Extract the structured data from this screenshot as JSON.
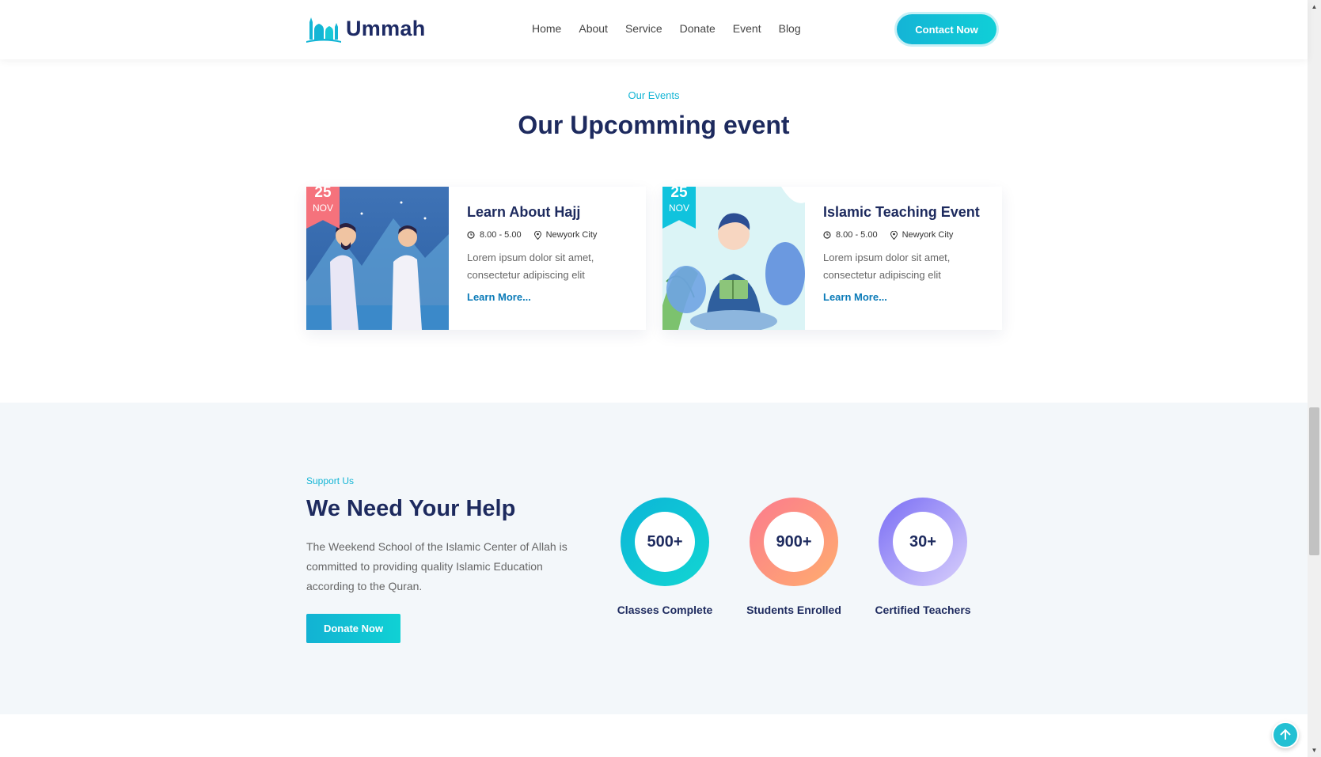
{
  "header": {
    "logo_text": "Ummah",
    "nav": [
      "Home",
      "About",
      "Service",
      "Donate",
      "Event",
      "Blog"
    ],
    "contact_label": "Contact Now"
  },
  "events_section": {
    "subtitle": "Our Events",
    "title": "Our Upcomming event",
    "events": [
      {
        "day": "25",
        "month": "NOV",
        "title": "Learn About Hajj",
        "time": "8.00 - 5.00",
        "location": "Newyork City",
        "description": "Lorem ipsum dolor sit amet, consectetur adipiscing elit",
        "link": "Learn More...",
        "tag_color": "#f5727c"
      },
      {
        "day": "25",
        "month": "NOV",
        "title": "Islamic Teaching Event",
        "time": "8.00 - 5.00",
        "location": "Newyork City",
        "description": "Lorem ipsum dolor sit amet, consectetur adipiscing elit",
        "link": "Learn More...",
        "tag_color": "#10c3dd"
      }
    ]
  },
  "help_section": {
    "subtitle": "Support Us",
    "title": "We Need Your Help",
    "description": "The Weekend School of the Islamic Center of Allah is committed to providing quality Islamic Education according to the Quran.",
    "donate_label": "Donate Now",
    "stats": [
      {
        "value": "500+",
        "label": "Classes Complete",
        "color_from": "#0cb5d8",
        "color_to": "#12d6d2"
      },
      {
        "value": "900+",
        "label": "Students Enrolled",
        "color_from": "#fb7b8e",
        "color_to": "#ffad6e"
      },
      {
        "value": "30+",
        "label": "Certified Teachers",
        "color_from": "#7a6ef5",
        "color_to": "#d9d0fb"
      }
    ]
  },
  "colors": {
    "accent": "#13b5d5",
    "heading": "#1d2a5e"
  }
}
